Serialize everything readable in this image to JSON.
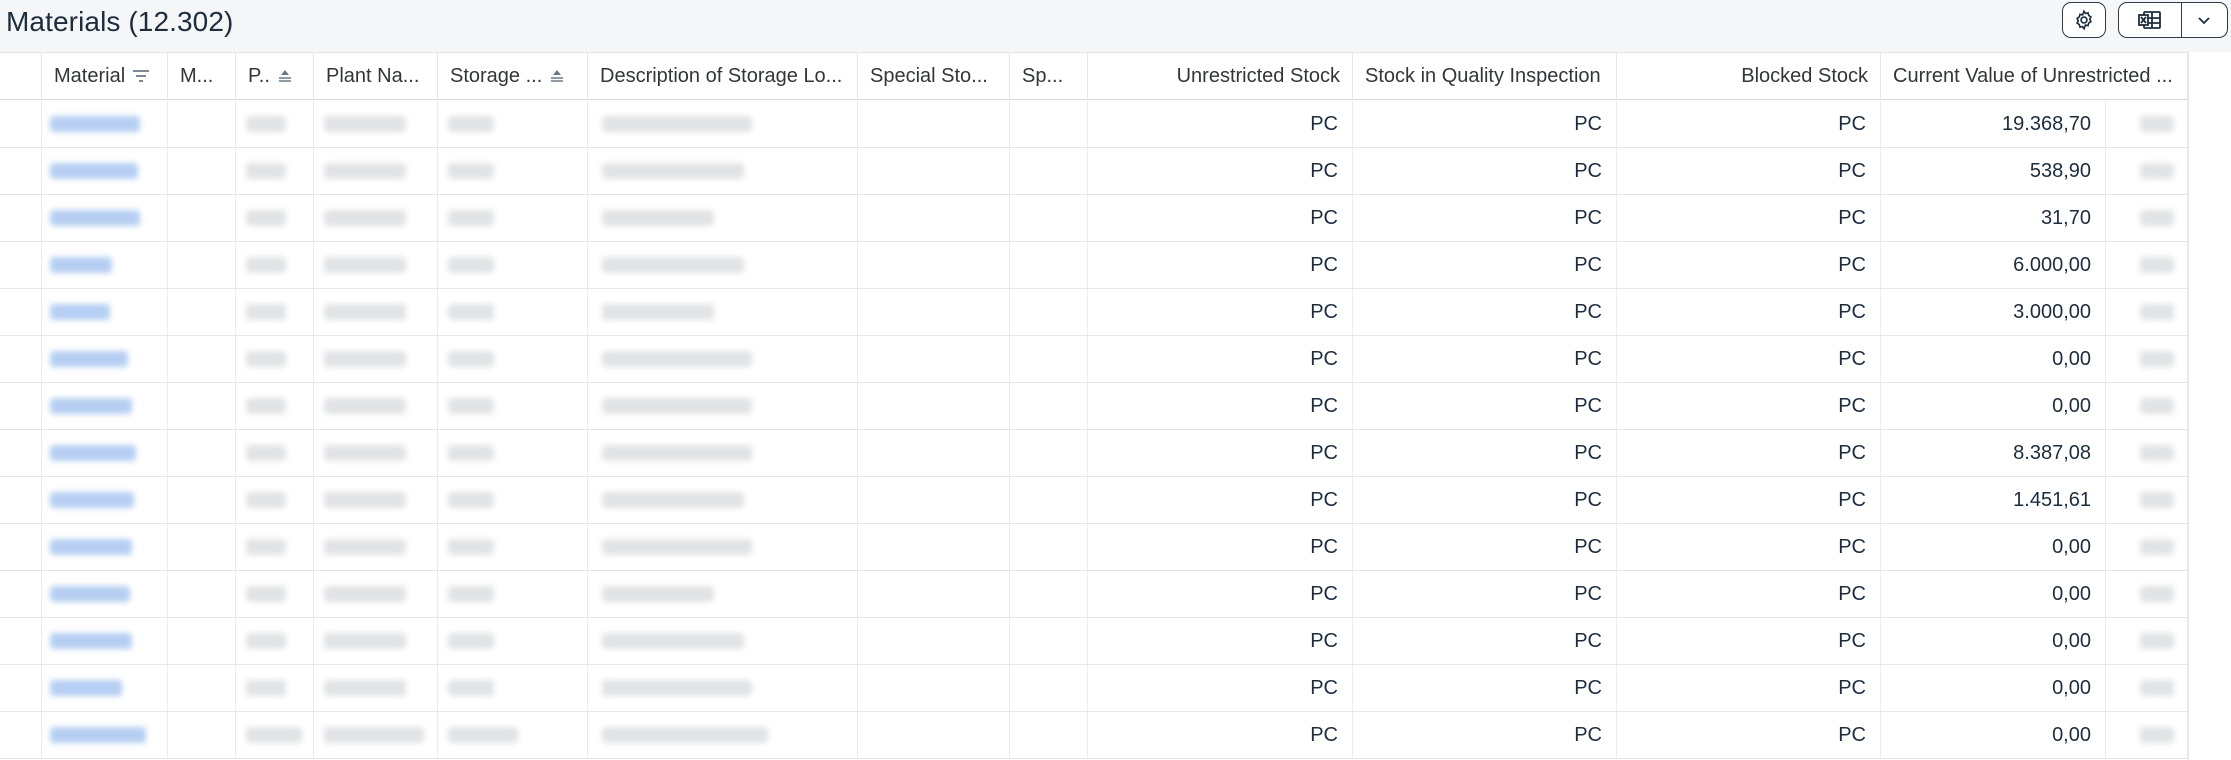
{
  "header": {
    "title": "Materials (12.302)",
    "settings_icon": "gear-icon",
    "export_icon": "spreadsheet-export-icon",
    "menu_icon": "chevron-down-icon"
  },
  "columns": [
    {
      "label": "Material",
      "icon": "filter-icon"
    },
    {
      "label": "M..."
    },
    {
      "label": "P..",
      "icon": "sort-ascending-icon"
    },
    {
      "label": "Plant Na..."
    },
    {
      "label": "Storage ...",
      "icon": "sort-ascending-icon"
    },
    {
      "label": "Description of Storage Lo..."
    },
    {
      "label": "Special Sto..."
    },
    {
      "label": "Sp..."
    },
    {
      "label": "Unrestricted Stock"
    },
    {
      "label": "Stock in Quality Inspection"
    },
    {
      "label": "Blocked Stock"
    },
    {
      "label": "Current Value of Unrestricted ..."
    }
  ],
  "rows": [
    {
      "unrestricted": "PC",
      "quality": "PC",
      "blocked": "PC",
      "value": "19.368,70"
    },
    {
      "unrestricted": "PC",
      "quality": "PC",
      "blocked": "PC",
      "value": "538,90"
    },
    {
      "unrestricted": "PC",
      "quality": "PC",
      "blocked": "PC",
      "value": "31,70"
    },
    {
      "unrestricted": "PC",
      "quality": "PC",
      "blocked": "PC",
      "value": "6.000,00"
    },
    {
      "unrestricted": "PC",
      "quality": "PC",
      "blocked": "PC",
      "value": "3.000,00"
    },
    {
      "unrestricted": "PC",
      "quality": "PC",
      "blocked": "PC",
      "value": "0,00"
    },
    {
      "unrestricted": "PC",
      "quality": "PC",
      "blocked": "PC",
      "value": "0,00"
    },
    {
      "unrestricted": "PC",
      "quality": "PC",
      "blocked": "PC",
      "value": "8.387,08"
    },
    {
      "unrestricted": "PC",
      "quality": "PC",
      "blocked": "PC",
      "value": "1.451,61"
    },
    {
      "unrestricted": "PC",
      "quality": "PC",
      "blocked": "PC",
      "value": "0,00"
    },
    {
      "unrestricted": "PC",
      "quality": "PC",
      "blocked": "PC",
      "value": "0,00"
    },
    {
      "unrestricted": "PC",
      "quality": "PC",
      "blocked": "PC",
      "value": "0,00"
    },
    {
      "unrestricted": "PC",
      "quality": "PC",
      "blocked": "PC",
      "value": "0,00"
    },
    {
      "unrestricted": "PC",
      "quality": "PC",
      "blocked": "PC",
      "value": "0,00"
    }
  ]
}
